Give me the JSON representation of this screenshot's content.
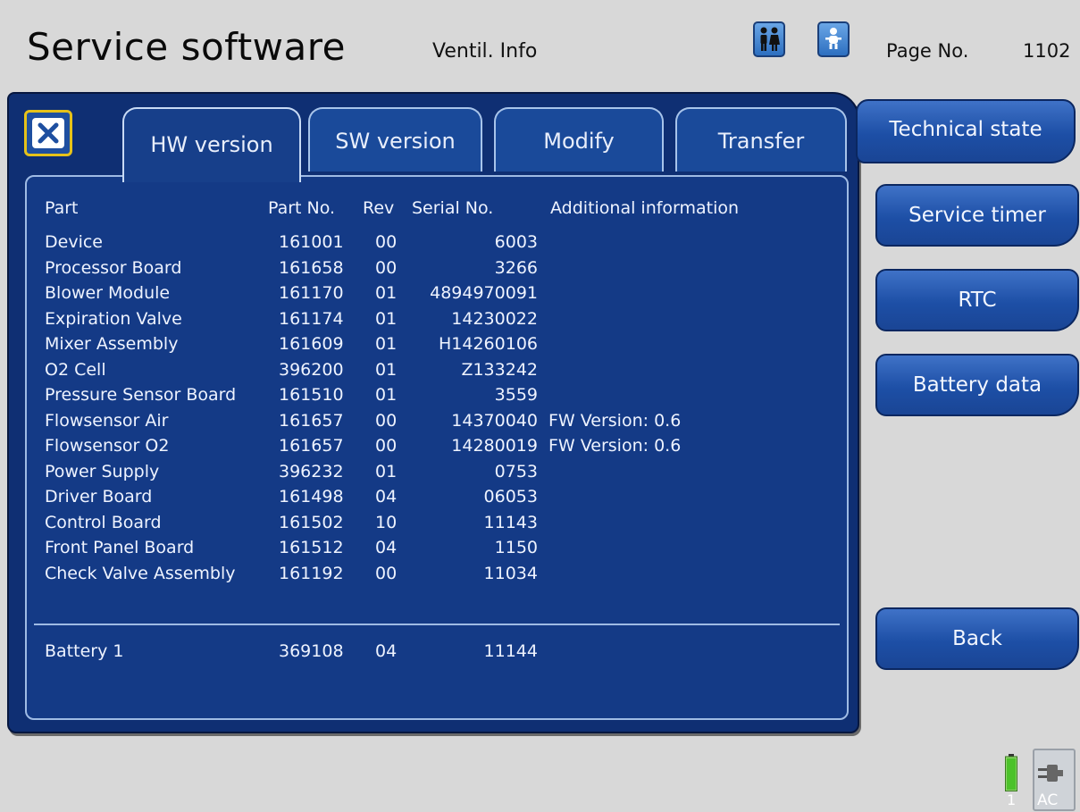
{
  "header": {
    "title": "Service software",
    "screen_name": "Ventil. Info",
    "page_label": "Page No.",
    "page_number": "1102",
    "mode_buttons": [
      {
        "icon": "adult-patients-icon"
      },
      {
        "icon": "infant-patient-icon"
      }
    ]
  },
  "tabs": [
    {
      "label": "HW version",
      "active": true
    },
    {
      "label": "SW version",
      "active": false
    },
    {
      "label": "Modify",
      "active": false
    },
    {
      "label": "Transfer",
      "active": false
    }
  ],
  "table": {
    "headers": {
      "part": "Part",
      "part_no": "Part No.",
      "rev": "Rev",
      "serial_no": "Serial No.",
      "additional": "Additional information"
    },
    "rows": [
      {
        "part": "Device",
        "part_no": "161001",
        "rev": "00",
        "serial": "6003",
        "info": ""
      },
      {
        "part": "Processor Board",
        "part_no": "161658",
        "rev": "00",
        "serial": "3266",
        "info": ""
      },
      {
        "part": "Blower Module",
        "part_no": "161170",
        "rev": "01",
        "serial": "4894970091",
        "info": ""
      },
      {
        "part": "Expiration Valve",
        "part_no": "161174",
        "rev": "01",
        "serial": "14230022",
        "info": ""
      },
      {
        "part": "Mixer Assembly",
        "part_no": "161609",
        "rev": "01",
        "serial": "H14260106",
        "info": ""
      },
      {
        "part": "O2 Cell",
        "part_no": "396200",
        "rev": "01",
        "serial": "Z133242",
        "info": ""
      },
      {
        "part": "Pressure Sensor Board",
        "part_no": "161510",
        "rev": "01",
        "serial": "3559",
        "info": ""
      },
      {
        "part": "Flowsensor Air",
        "part_no": "161657",
        "rev": "00",
        "serial": "14370040",
        "info": "FW Version: 0.6"
      },
      {
        "part": "Flowsensor O2",
        "part_no": "161657",
        "rev": "00",
        "serial": "14280019",
        "info": "FW Version: 0.6"
      },
      {
        "part": "Power Supply",
        "part_no": "396232",
        "rev": "01",
        "serial": "0753",
        "info": ""
      },
      {
        "part": "Driver Board",
        "part_no": "161498",
        "rev": "04",
        "serial": "06053",
        "info": ""
      },
      {
        "part": "Control Board",
        "part_no": "161502",
        "rev": "10",
        "serial": "11143",
        "info": ""
      },
      {
        "part": "Front Panel Board",
        "part_no": "161512",
        "rev": "04",
        "serial": "1150",
        "info": ""
      },
      {
        "part": "Check Valve Assembly",
        "part_no": "161192",
        "rev": "00",
        "serial": "11034",
        "info": ""
      }
    ],
    "battery_row": {
      "part": "Battery 1",
      "part_no": "369108",
      "rev": "04",
      "serial": "11144",
      "info": ""
    }
  },
  "side_menu": {
    "technical_state": "Technical state",
    "service_timer": "Service timer",
    "rtc": "RTC",
    "battery_data": "Battery data",
    "back": "Back"
  },
  "status": {
    "battery_number": "1",
    "ac_label": "AC",
    "battery_level": 1.0,
    "colors": {
      "battery": "#6fdc3c",
      "panel": "#143a86"
    }
  }
}
